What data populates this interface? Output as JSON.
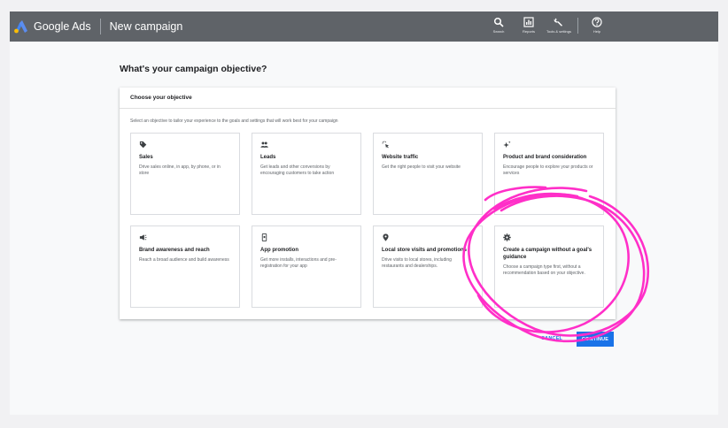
{
  "header": {
    "brand": "Google Ads",
    "campaign_title": "New campaign",
    "tools": [
      {
        "label": "Search",
        "icon": "search-icon"
      },
      {
        "label": "Reports",
        "icon": "reports-icon"
      },
      {
        "label": "Tools & settings",
        "icon": "wrench-icon"
      },
      {
        "label": "Help",
        "icon": "help-icon"
      }
    ]
  },
  "main": {
    "page_title": "What's your campaign objective?",
    "panel_title": "Choose your objective",
    "panel_description": "Select an objective to tailor your experience to the goals and settings that will work best for your campaign"
  },
  "objectives": [
    {
      "title": "Sales",
      "description": "Drive sales online, in app, by phone, or in store",
      "icon": "tag-icon"
    },
    {
      "title": "Leads",
      "description": "Get leads and other conversions by encouraging customers to take action",
      "icon": "people-icon"
    },
    {
      "title": "Website traffic",
      "description": "Get the right people to visit your website",
      "icon": "cursor-click-icon"
    },
    {
      "title": "Product and brand consideration",
      "description": "Encourage people to explore your products or services",
      "icon": "sparkle-icon"
    },
    {
      "title": "Brand awareness and reach",
      "description": "Reach a broad audience and build awareness",
      "icon": "megaphone-icon"
    },
    {
      "title": "App promotion",
      "description": "Get more installs, interactions and pre-registration for your app",
      "icon": "phone-icon"
    },
    {
      "title": "Local store visits and promotions",
      "description": "Drive visits to local stores, including restaurants and dealerships.",
      "icon": "location-pin-icon"
    },
    {
      "title": "Create a campaign without a goal's guidance",
      "description": "Choose a campaign type first, without a recommendation based on your objective.",
      "icon": "gear-icon"
    }
  ],
  "footer": {
    "cancel_label": "CANCEL",
    "continue_label": "CONTINUE"
  },
  "colors": {
    "topbar": "#5f6368",
    "accent": "#1a73e8",
    "annotation": "#ff2fc8"
  }
}
